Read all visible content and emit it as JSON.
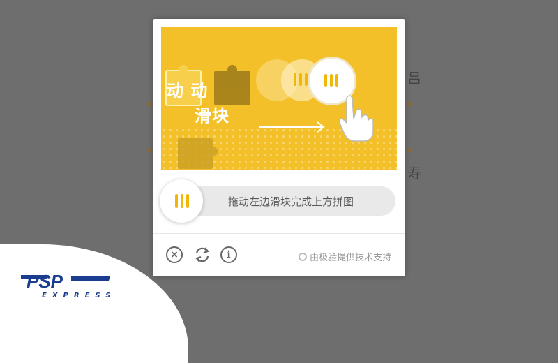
{
  "background": {
    "hint1": "吕",
    "hint2": "寿"
  },
  "captcha": {
    "animation_text_line1": "动 动",
    "animation_text_line2": "滑块",
    "slider_hint": "拖动左边滑块完成上方拼图",
    "footer": {
      "close_icon": "close-icon",
      "refresh_icon": "refresh-icon",
      "info_icon": "info-icon",
      "brand": "由极验提供技术支持"
    },
    "colors": {
      "puzzle_bg": "#f3c02a",
      "accent": "#f2b705"
    }
  },
  "watermark": {
    "logo": "PSP",
    "sub": "EXPRESS",
    "color": "#1a3d8f"
  }
}
